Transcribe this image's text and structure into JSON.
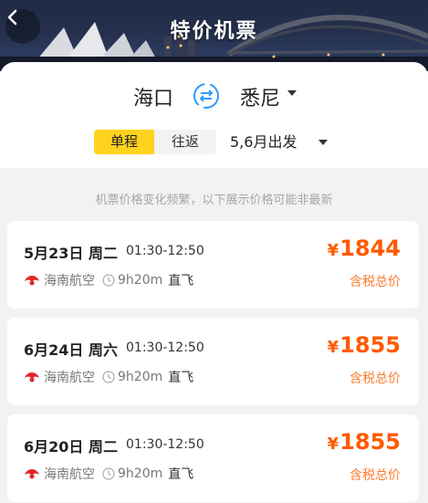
{
  "header": {
    "title": "特价机票",
    "back_icon": "chevron-left-icon"
  },
  "route": {
    "from": "海口",
    "to": "悉尼",
    "swap_icon": "swap-icon"
  },
  "trip_type": {
    "options": [
      "单程",
      "往返"
    ],
    "selected": "单程"
  },
  "date_filter": "5,6月出发",
  "notice": "机票价格变化频繁，以下展示价格可能非最新",
  "flights": [
    {
      "date": "5月23日 周二",
      "time": "01:30-12:50",
      "airline": "海南航空",
      "duration": "9h20m",
      "type": "直飞",
      "currency": "¥",
      "price": "1844",
      "price_note": "含税总价"
    },
    {
      "date": "6月24日 周六",
      "time": "01:30-12:50",
      "airline": "海南航空",
      "duration": "9h20m",
      "type": "直飞",
      "currency": "¥",
      "price": "1855",
      "price_note": "含税总价"
    },
    {
      "date": "6月20日 周二",
      "time": "01:30-12:50",
      "airline": "海南航空",
      "duration": "9h20m",
      "type": "直飞",
      "currency": "¥",
      "price": "1855",
      "price_note": "含税总价"
    }
  ],
  "colors": {
    "accent_yellow": "#ffd21f",
    "price_orange": "#ff5a00",
    "swap_blue": "#2f9bff",
    "airline_red": "#e0262b"
  }
}
